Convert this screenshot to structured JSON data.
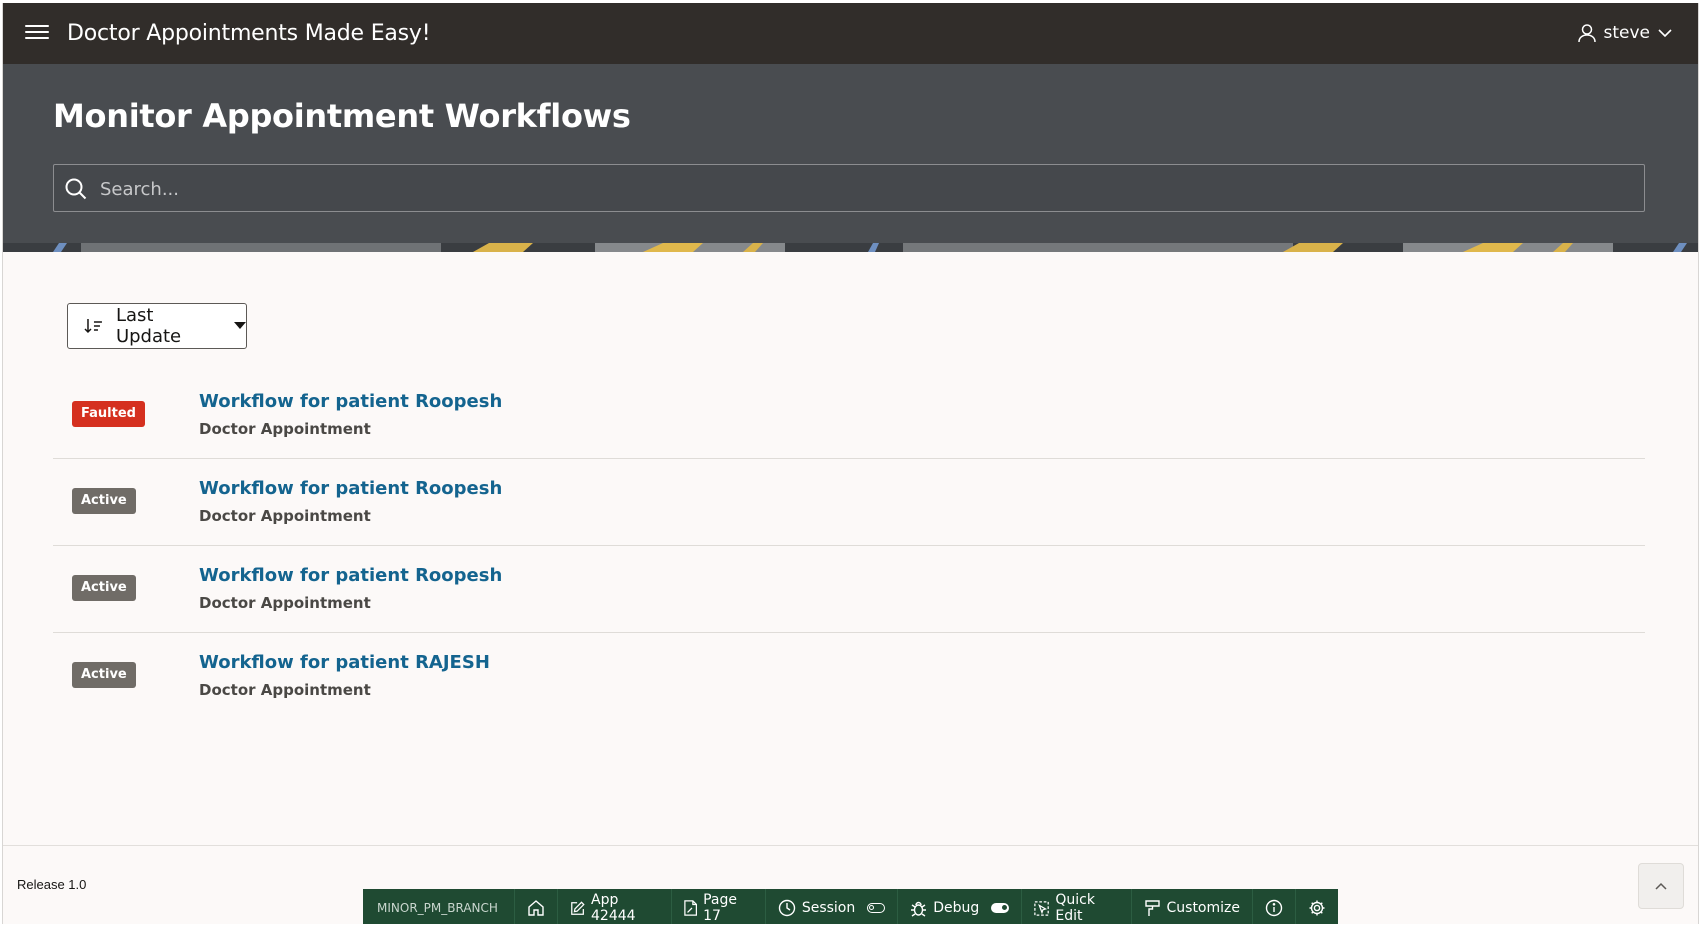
{
  "app": {
    "title": "Doctor Appointments Made Easy!",
    "user": "steve"
  },
  "page": {
    "title": "Monitor Appointment Workflows"
  },
  "search": {
    "placeholder": "Search..."
  },
  "sort": {
    "label": "Last Update"
  },
  "workflows": [
    {
      "status": "Faulted",
      "title": "Workflow for patient Roopesh",
      "subtitle": "Doctor Appointment"
    },
    {
      "status": "Active",
      "title": "Workflow for patient Roopesh",
      "subtitle": "Doctor Appointment"
    },
    {
      "status": "Active",
      "title": "Workflow for patient Roopesh",
      "subtitle": "Doctor Appointment"
    },
    {
      "status": "Active",
      "title": "Workflow for patient RAJESH",
      "subtitle": "Doctor Appointment"
    }
  ],
  "footer": {
    "release": "Release 1.0"
  },
  "devbar": {
    "branch": "MINOR_PM_BRANCH",
    "app": "App 42444",
    "page": "Page 17",
    "session": "Session",
    "debug": "Debug",
    "quick_edit": "Quick Edit",
    "customize": "Customize"
  },
  "colors": {
    "header": "#312d2a",
    "hero": "#494c50",
    "faulted": "#d5301f",
    "active": "#706c67",
    "link": "#14648f",
    "devbar": "#1f4a32"
  },
  "icons": [
    "menu-icon",
    "user-icon",
    "chevron-down-icon",
    "search-icon",
    "sort-icon",
    "caret-down-icon",
    "home-icon",
    "edit-icon",
    "page-icon",
    "clock-icon",
    "bug-icon",
    "quick-edit-icon",
    "paint-icon",
    "info-icon",
    "gear-icon",
    "chevron-up-icon"
  ]
}
